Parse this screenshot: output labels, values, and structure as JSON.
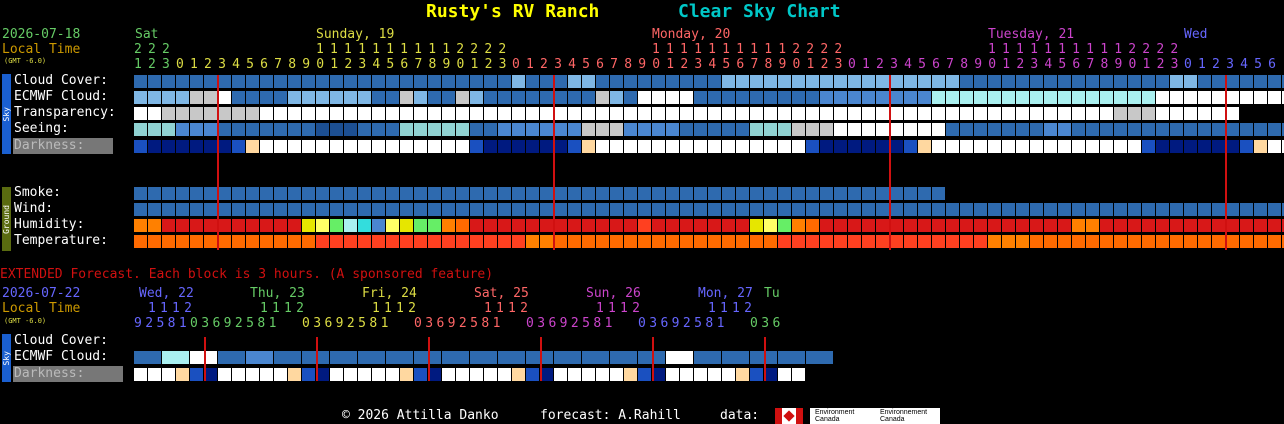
{
  "header": {
    "site_name": "Rusty's RV Ranch",
    "chart_name": "Clear Sky Chart",
    "colors": {
      "site": "#ffff00",
      "chart": "#00c8c8"
    }
  },
  "main": {
    "date": "2026-07-18",
    "local_time": "Local Time",
    "gmt": "(GMT -6.0)",
    "day_labels": [
      {
        "text": "Sat",
        "color": "#66cc66"
      },
      {
        "text": "Sunday, 19",
        "color": "#dddd44"
      },
      {
        "text": "Monday, 20",
        "color": "#ff6666"
      },
      {
        "text": "Tuesday, 21",
        "color": "#cc44cc"
      },
      {
        "text": "Wed",
        "color": "#6666ff"
      }
    ],
    "hours_tens_row": [
      {
        "text": "222",
        "color": "#66cc66"
      },
      {
        "text": "11111111112222",
        "color": "#dddd44"
      },
      {
        "text": "11111111112222",
        "color": "#ff6666"
      },
      {
        "text": "11111111112222",
        "color": "#cc44cc"
      }
    ],
    "hours_ones_row": [
      {
        "text": "123",
        "color": "#66cc66"
      },
      {
        "text": "012345678901234567890123",
        "color": "#dddd44"
      },
      {
        "text": "012345678901234567890123",
        "color": "#ff6666"
      },
      {
        "text": "012345678901234567890123",
        "color": "#cc44cc"
      },
      {
        "text": "0123456",
        "color": "#6666ff"
      }
    ],
    "sky_tab": "Sky",
    "ground_tab": "Ground",
    "rows": {
      "cloud": "Cloud Cover:",
      "ecmwf": "ECMWF Cloud:",
      "transparency": "Transparency:",
      "seeing": "Seeing:",
      "darkness": "Darkness:",
      "smoke": "Smoke:",
      "wind": "Wind:",
      "humidity": "Humidity:",
      "temperature": "Temperature:"
    }
  },
  "extended": {
    "note": "EXTENDED Forecast. Each block is 3 hours. (A sponsored feature)",
    "date": "2026-07-22",
    "local_time": "Local Time",
    "gmt": "(GMT -6.0)",
    "day_labels": [
      {
        "text": "Wed, 22",
        "color": "#6666ff"
      },
      {
        "text": "Thu, 23",
        "color": "#66cc66"
      },
      {
        "text": "Fri, 24",
        "color": "#dddd44"
      },
      {
        "text": "Sat, 25",
        "color": "#ff6666"
      },
      {
        "text": "Sun, 26",
        "color": "#cc44cc"
      },
      {
        "text": "Mon, 27",
        "color": "#6666ff"
      },
      {
        "text": "Tu",
        "color": "#66cc66"
      }
    ],
    "tens_row": [
      {
        "text": "1112",
        "color": "#6666ff"
      },
      {
        "text": "1112",
        "color": "#66cc66"
      },
      {
        "text": "1112",
        "color": "#dddd44"
      },
      {
        "text": "1112",
        "color": "#ff6666"
      },
      {
        "text": "1112",
        "color": "#cc44cc"
      },
      {
        "text": "1112",
        "color": "#6666ff"
      }
    ],
    "ones_row": [
      {
        "text": "92581",
        "color": "#6666ff"
      },
      {
        "text": "03692581",
        "color": "#66cc66"
      },
      {
        "text": "03692581",
        "color": "#dddd44"
      },
      {
        "text": "03692581",
        "color": "#ff6666"
      },
      {
        "text": "03692581",
        "color": "#cc44cc"
      },
      {
        "text": "03692581",
        "color": "#6666ff"
      },
      {
        "text": "036",
        "color": "#66cc66"
      }
    ],
    "rows": {
      "cloud": "Cloud Cover:",
      "ecmwf": "ECMWF Cloud:",
      "darkness": "Darkness:"
    }
  },
  "footer": {
    "copyright": "© 2026 Attilla Danko",
    "forecast": "forecast: A.Rahill",
    "data": "data:",
    "logo1": "Environment Canada",
    "logo2": "Environnement Canada"
  },
  "grid": {
    "main_blocks": 83,
    "ext_blocks": 25,
    "smoke_blocks": 58,
    "midnight_blocks_main": [
      3,
      27,
      51,
      75
    ],
    "midnight_blocks_ext": [
      2,
      10,
      18,
      26,
      34,
      42
    ],
    "rows": {
      "cloud": "BBBBBBBBBBBBBBBBBBBBBBBBBBBLBBBLLBBBBBBBBBLLLLLLLLLLLLLLLLLBBBBBBBBBBBBBBBLLBBBBBBBBB",
      "ecmwf": "LLLLGGWBBBBLLLLLLBBGLBBGLBBBBBBBBGLBWWWWBBBBBBBBBMMMMMMMMCCCCCCCCCCCCCCCCWWWWWWWWWWW",
      "transparency": "WWGGGGGGGWWWWWWWWWWWWWWWWWWWWWWWWWWWWWWWWWWWWWWWWWWWWWWWWWWWWWWWWWWWWWGGGWWWWWW",
      "seeing": "TTTMMMBBBBBBBDDDBBBTTTTTBBMMMMMMGGGMMMMBBBBBTTTGGGWWWWWWWWBBBBBBBMMBBBBBBBBBBBBBBBBBB",
      "smoke": "BBBBBBBBBBBBBBBBBBBBBBBBBBBBBBBBBBBBBBBBBBBBBBBBBBBBBBBBBB",
      "wind": "BBBBBBBBBBBBBBBBBBBBBBBBBBBBBBBBBBBBBBBBBBBBBBBBBBBBBBBBBBBBBBBBBBBBBBBBBBBBBBBBBBB",
      "humidity": "ooRRRRRRRRRRyYgCcMYyggoORRRRRRRRRRRRrRRRRRRRyYgoORRRRRRRRRRRRRRRRRRooRRRRRRRRRRRRRRR",
      "temperature": "OOOOOOOOOOOOOrrrrrrrrrrrrrrrooOOOOOOOOOOOOOOOOrrrrrrrrrrrrrrroooOOOOOOOOOOOOOOOOOOOrr",
      "ext_cloud": "BCWBMBBBBBBBBBBBBBBWBBBBB",
      "ext_ecmwf": "BBBBBBBBBBBBBBBBBBBBBBBBB"
    }
  }
}
